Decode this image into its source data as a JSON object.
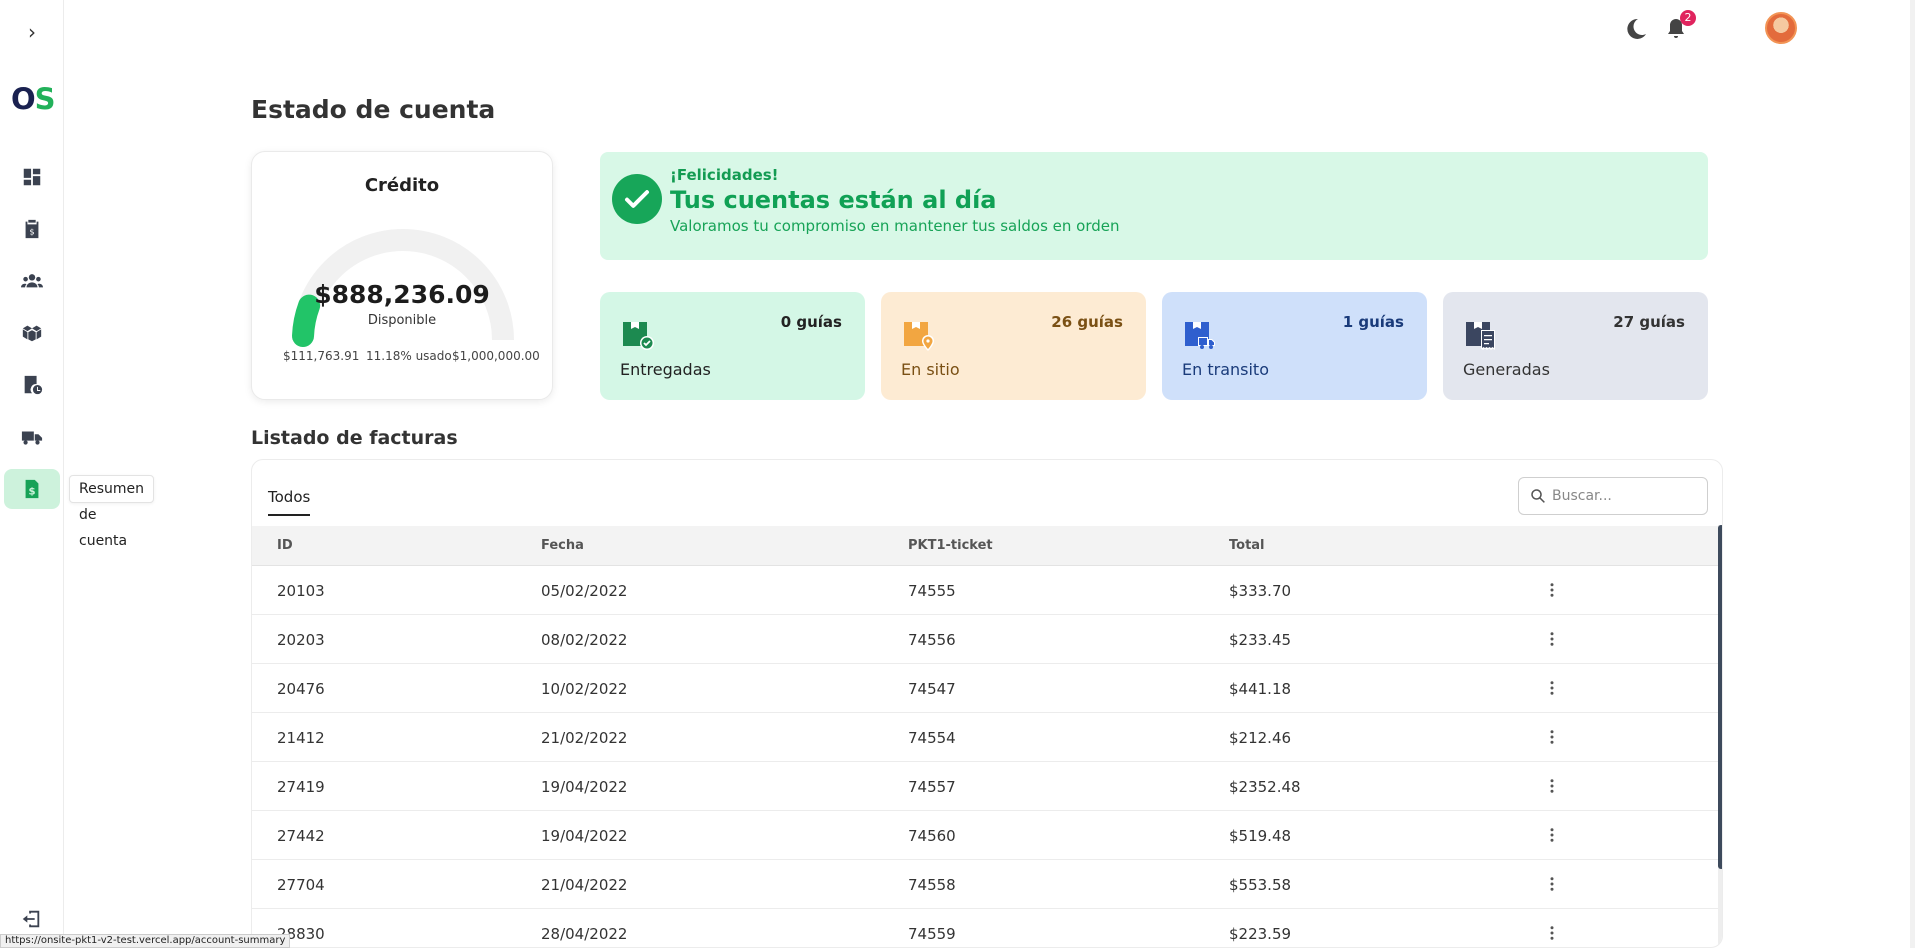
{
  "sidebar": {
    "logo_o": "O",
    "logo_s": "S",
    "tooltip": "Resumen de cuenta"
  },
  "topbar": {
    "notification_count": "2"
  },
  "page": {
    "title": "Estado de cuenta"
  },
  "credit": {
    "title": "Crédito",
    "amount": "$888,236.09",
    "sub": "Disponible",
    "min": "$111,763.91",
    "used": "11.18% usado",
    "max": "$1,000,000.00",
    "used_fraction": 0.1118
  },
  "congrats": {
    "pre": "¡Felicidades!",
    "title": "Tus cuentas están al día",
    "text": "Valoramos tu compromiso en mantener tus saldos en orden"
  },
  "stats": [
    {
      "count": "0 guías",
      "label": "Entregadas",
      "bg": "#d4f7e6",
      "fg": "#222",
      "icon_color": "#1c8a50"
    },
    {
      "count": "26 guías",
      "label": "En sitio",
      "bg": "#fdebd3",
      "fg": "#7a5014",
      "icon_color": "#f2a641"
    },
    {
      "count": "1 guías",
      "label": "En transito",
      "bg": "#cfe0fa",
      "fg": "#1a3b7a",
      "icon_color": "#2f5fce"
    },
    {
      "count": "27 guías",
      "label": "Generadas",
      "bg": "#e3e6ee",
      "fg": "#333",
      "icon_color": "#3b4660"
    }
  ],
  "invoices": {
    "title": "Listado de facturas",
    "tab": "Todos",
    "search_placeholder": "Buscar...",
    "columns": [
      "ID",
      "Fecha",
      "PKT1-ticket",
      "Total"
    ],
    "rows": [
      [
        "20103",
        "05/02/2022",
        "74555",
        "$333.70"
      ],
      [
        "20203",
        "08/02/2022",
        "74556",
        "$233.45"
      ],
      [
        "20476",
        "10/02/2022",
        "74547",
        "$441.18"
      ],
      [
        "21412",
        "21/02/2022",
        "74554",
        "$212.46"
      ],
      [
        "27419",
        "19/04/2022",
        "74557",
        "$2352.48"
      ],
      [
        "27442",
        "19/04/2022",
        "74560",
        "$519.48"
      ],
      [
        "27704",
        "21/04/2022",
        "74558",
        "$553.58"
      ],
      [
        "28830",
        "28/04/2022",
        "74559",
        "$223.59"
      ]
    ]
  },
  "status_url": "https://onsite-pkt1-v2-test.vercel.app/account-summary",
  "colors": {
    "accent_green": "#17a659",
    "nav_active_bg": "#cdf2dc"
  }
}
